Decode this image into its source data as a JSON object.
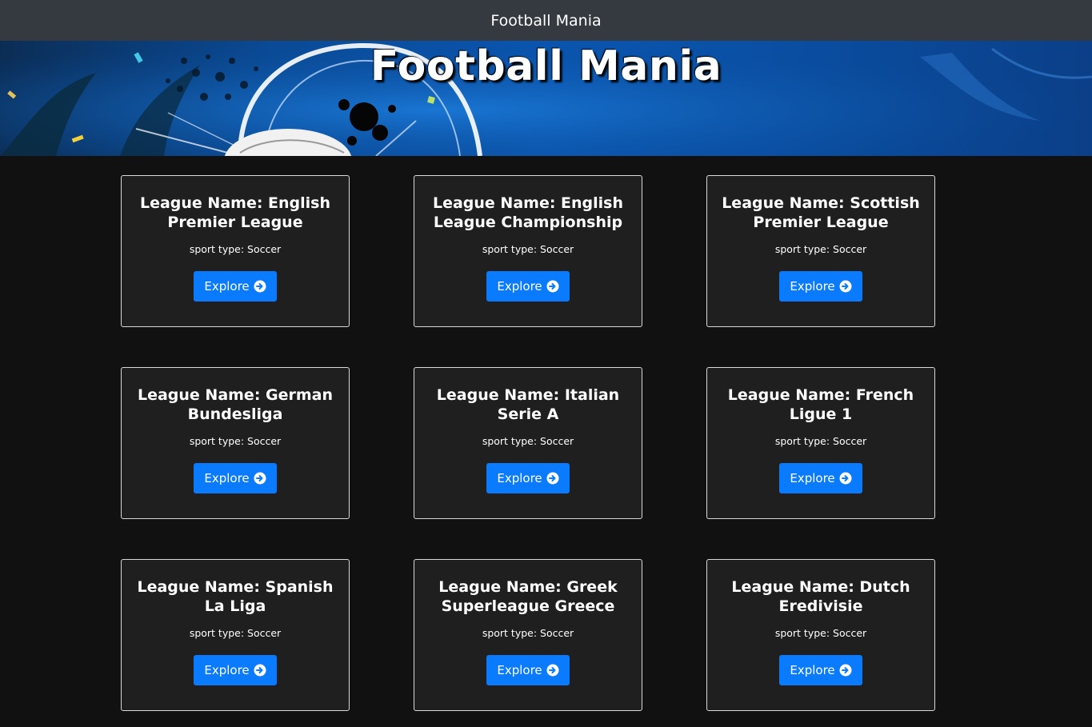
{
  "navbar": {
    "title": "Football Mania"
  },
  "hero": {
    "title": "Football Mania"
  },
  "leagues": [
    {
      "title": "League Name: English Premier League",
      "sport": "sport type: Soccer",
      "button": "Explore"
    },
    {
      "title": "League Name: English League Championship",
      "sport": "sport type: Soccer",
      "button": "Explore"
    },
    {
      "title": "League Name: Scottish Premier League",
      "sport": "sport type: Soccer",
      "button": "Explore"
    },
    {
      "title": "League Name: German Bundesliga",
      "sport": "sport type: Soccer",
      "button": "Explore"
    },
    {
      "title": "League Name: Italian Serie A",
      "sport": "sport type: Soccer",
      "button": "Explore"
    },
    {
      "title": "League Name: French Ligue 1",
      "sport": "sport type: Soccer",
      "button": "Explore"
    },
    {
      "title": "League Name: Spanish La Liga",
      "sport": "sport type: Soccer",
      "button": "Explore"
    },
    {
      "title": "League Name: Greek Superleague Greece",
      "sport": "sport type: Soccer",
      "button": "Explore"
    },
    {
      "title": "League Name: Dutch Eredivisie",
      "sport": "sport type: Soccer",
      "button": "Explore"
    }
  ],
  "icons": {
    "explore": "arrow-circle-right-icon",
    "banner": "soccer-ball-banner"
  },
  "colors": {
    "accent": "#0a7bff",
    "navbar": "#343a40",
    "card": "#1f1f20",
    "page": "#111111"
  }
}
